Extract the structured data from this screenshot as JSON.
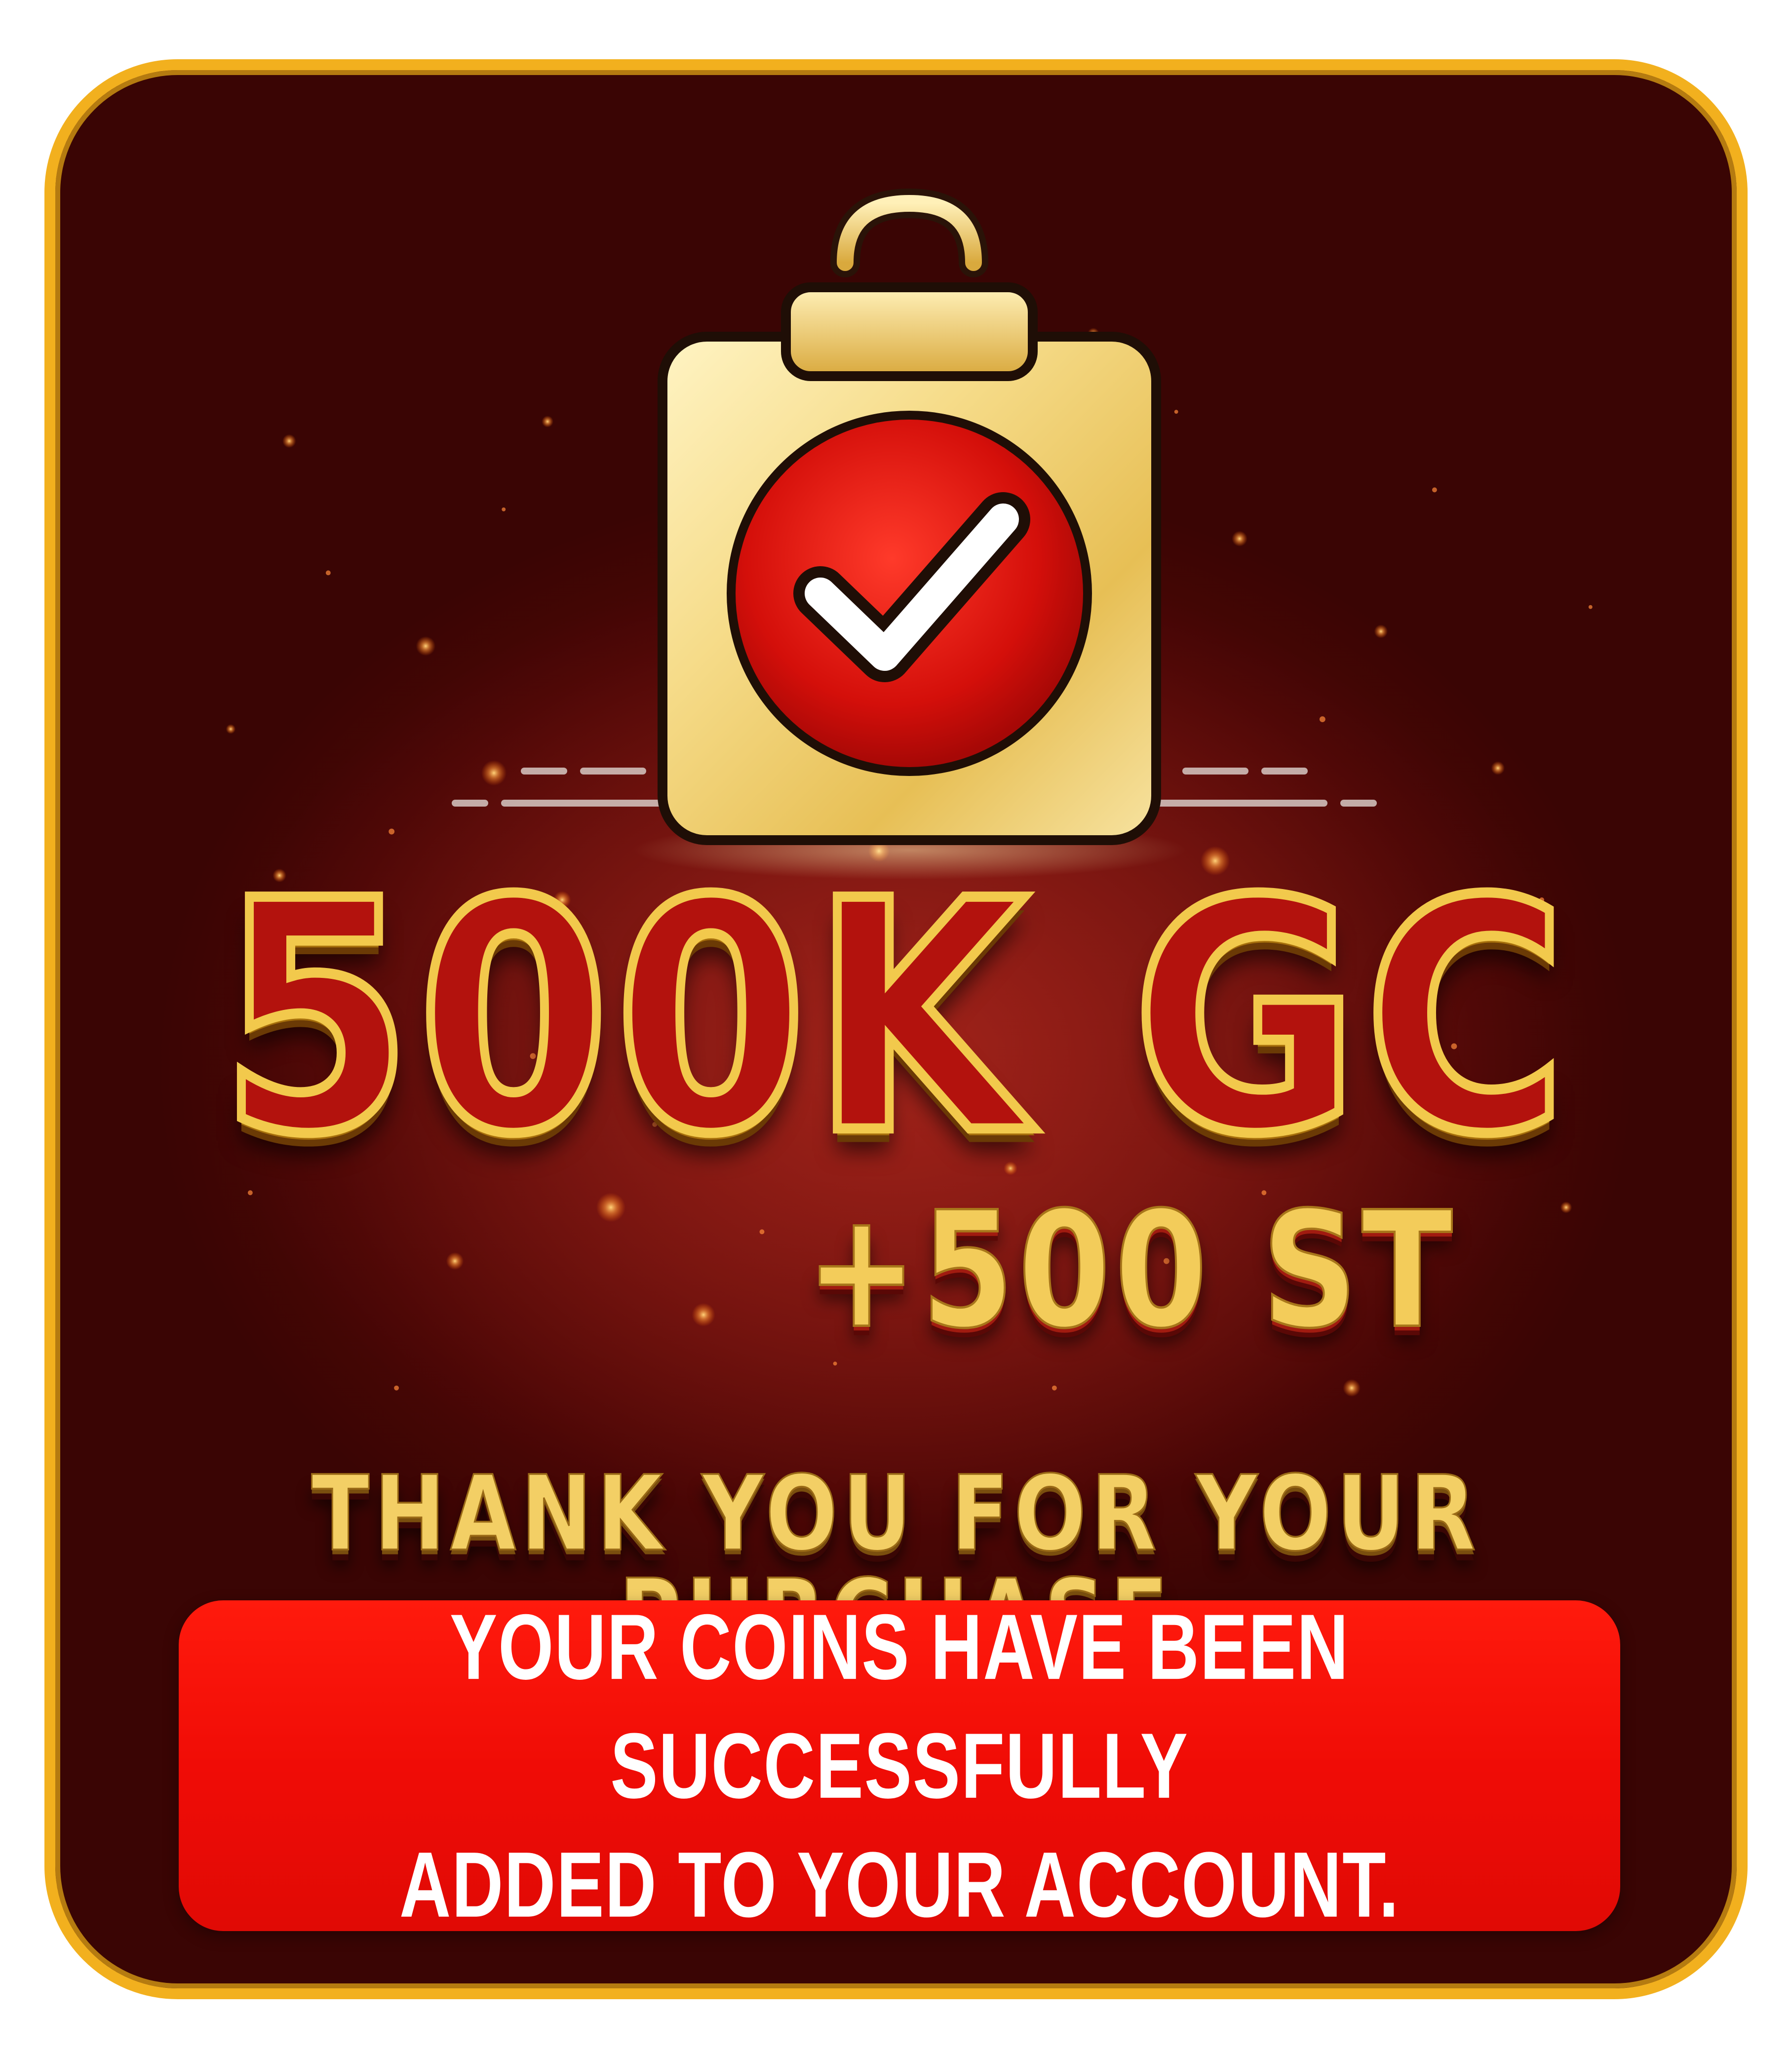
{
  "purchase": {
    "main_amount": "500K GC",
    "bonus_amount": "+500 ST",
    "thank_you": "THANK YOU FOR YOUR PURCHASE",
    "message_line1": "YOUR COINS HAVE BEEN SUCCESSFULLY",
    "message_line2": "ADDED TO YOUR ACCOUNT."
  },
  "icons": {
    "badge": "clipboard-check-icon"
  },
  "colors": {
    "background": "#5e0b08",
    "border": "#f2b01e",
    "gold": "#f3cf65",
    "message_box": "#f20c06",
    "check_circle": "#d8100c",
    "text_light": "#ffffff"
  }
}
